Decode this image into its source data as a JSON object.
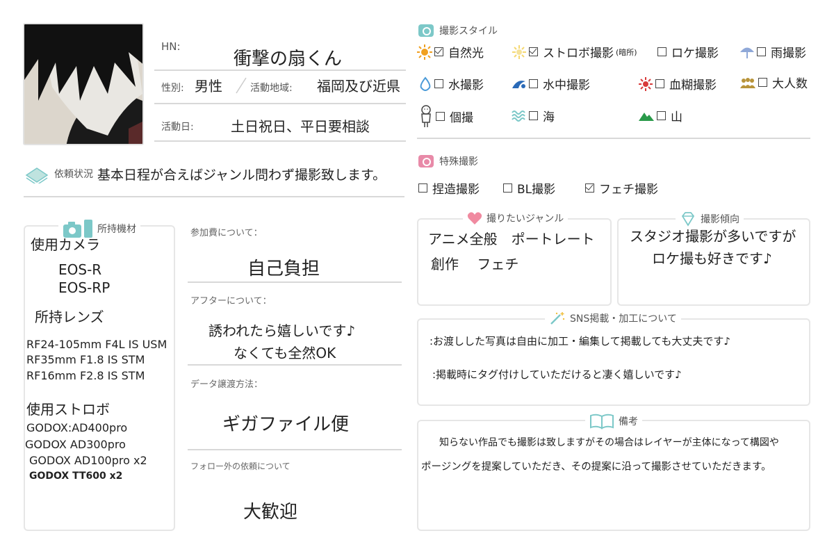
{
  "profile": {
    "hn_label": "HN:",
    "hn_value": "衝撃の扇くん",
    "gender_label": "性別:",
    "gender_value": "男性",
    "area_label": "活動地域:",
    "area_value": "福岡及び近県",
    "days_label": "活動日:",
    "days_value": "土日祝日、平日要相談"
  },
  "request": {
    "label": "依頼状況",
    "value": "基本日程が合えばジャンル問わず撮影致します。"
  },
  "equipment": {
    "title": "所持機材",
    "camera_heading": "使用カメラ",
    "cameras": [
      "EOS-R",
      "EOS-RP"
    ],
    "lens_heading": "所持レンズ",
    "lenses": [
      "RF24-105mm F4L IS USM",
      "RF35mm F1.8 IS STM",
      "RF16mm F2.8  IS STM"
    ],
    "strobe_heading": "使用ストロボ",
    "strobes": [
      "GODOX:AD400pro",
      "GODOX AD300pro",
      "GODOX AD100pro x2",
      "GODOX TT600 x2"
    ]
  },
  "terms": {
    "fee_label": "参加費について：",
    "fee_value": "自己負担",
    "after_label": "アフターについて：",
    "after_line1": "誘われたら嬉しいです♪",
    "after_line2": "なくても全然OK",
    "delivery_label": "データ譲渡方法：",
    "delivery_value": "ギガファイル便",
    "nonfollow_label": "フォロー外の依頼について",
    "nonfollow_value": "大歓迎"
  },
  "style": {
    "title": "撮影スタイル",
    "options": [
      {
        "label": "自然光",
        "checked": true,
        "icon": "sun-icon"
      },
      {
        "label": "ストロボ撮影",
        "suffix": "(暗所)",
        "checked": true,
        "icon": "flash-icon"
      },
      {
        "label": "ロケ撮影",
        "checked": false,
        "icon": ""
      },
      {
        "label": "雨撮影",
        "checked": false,
        "icon": "umbrella-icon"
      },
      {
        "label": "水撮影",
        "checked": false,
        "icon": "water-drop-icon"
      },
      {
        "label": "水中撮影",
        "checked": false,
        "icon": "swimmer-icon"
      },
      {
        "label": "血糊撮影",
        "checked": false,
        "icon": "splatter-icon"
      },
      {
        "label": "大人数",
        "checked": false,
        "icon": "group-icon"
      },
      {
        "label": "個撮",
        "checked": false,
        "icon": "person-icon"
      },
      {
        "label": "海",
        "checked": false,
        "icon": "waves-icon"
      },
      {
        "label": "山",
        "checked": false,
        "icon": "mountain-icon"
      }
    ]
  },
  "special": {
    "title": "特殊撮影",
    "options": [
      {
        "label": "捏造撮影",
        "checked": false
      },
      {
        "label": "BL撮影",
        "checked": false
      },
      {
        "label": "フェチ撮影",
        "checked": true
      }
    ]
  },
  "genre": {
    "title": "撮りたいジャンル",
    "line1": "アニメ全般　ポートレート",
    "line2": "創作　 フェチ"
  },
  "tendency": {
    "title": "撮影傾向",
    "line1": "スタジオ撮影が多いですが",
    "line2": "ロケ撮も好きです♪"
  },
  "sns": {
    "title": "SNS掲載・加工について",
    "line1": ":お渡しした写真は自由に加工・編集して掲載しても大丈夫です♪",
    "line2": ":掲載時にタグ付けしていただけると凄く嬉しいです♪"
  },
  "notes": {
    "title": "備考",
    "line1": "知らない作品でも撮影は致しますがその場合はレイヤーが主体になって構図や",
    "line2": "ポージングを提案していただき、その提案に沿って撮影させていただきます。"
  },
  "colors": {
    "accent_teal": "#7cc8c8",
    "accent_pink": "#e88aa8",
    "accent_sun": "#f0a020"
  }
}
